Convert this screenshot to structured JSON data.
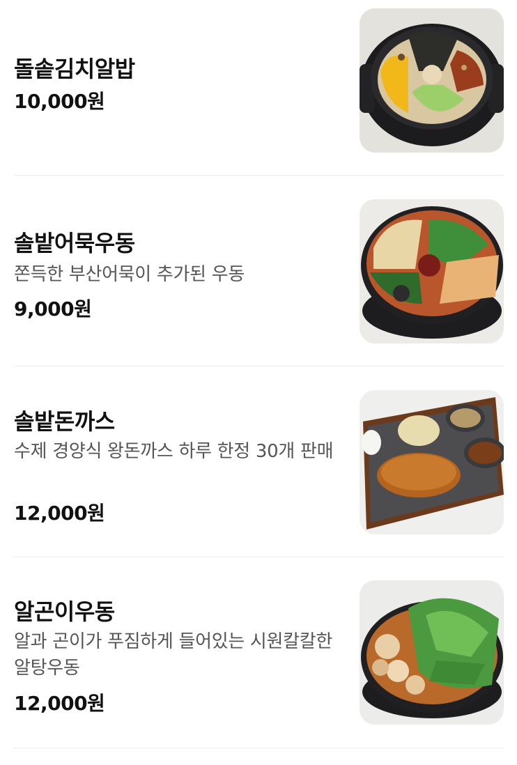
{
  "menu": {
    "items": [
      {
        "name": "돌솥김치알밥",
        "description": "",
        "price": "10,000원",
        "image": "stone-pot-kimchi-fish-roe-rice-photo"
      },
      {
        "name": "솔밭어묵우동",
        "description": "쫀득한 부산어묵이 추가된 우동",
        "price": "9,000원",
        "image": "fishcake-udon-photo"
      },
      {
        "name": "솔밭돈까스",
        "description": "수제 경양식 왕돈까스 하루 한정 30개 판매",
        "price": "12,000원",
        "image": "pork-cutlet-plate-photo"
      },
      {
        "name": "알곤이우동",
        "description": "알과 곤이가 푸짐하게 들어있는 시원칼칼한 알탕우동",
        "price": "12,000원",
        "image": "roe-milt-udon-photo"
      }
    ]
  },
  "colors": {
    "text_primary": "#111111",
    "text_secondary": "#555555",
    "divider": "#ececec",
    "background": "#ffffff"
  }
}
